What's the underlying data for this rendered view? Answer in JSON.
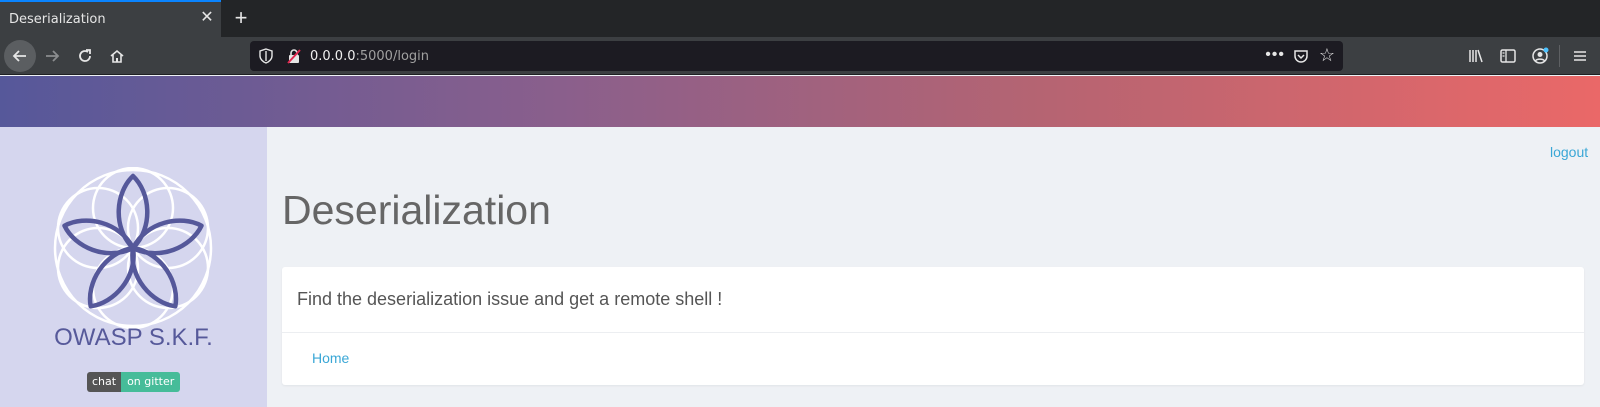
{
  "browser": {
    "tab_title": "Deserialization",
    "tab_close": "✕",
    "new_tab": "+",
    "url_host": "0.0.0.0",
    "url_path": ":5000/login",
    "url_more": "•••"
  },
  "sidebar": {
    "brand": "OWASP S.K.F.",
    "badge_left": "chat",
    "badge_right": "on gitter"
  },
  "header": {
    "logout": "logout"
  },
  "main": {
    "title": "Deserialization",
    "description": "Find the deserialization issue and get a remote shell !",
    "home_link": "Home"
  },
  "colors": {
    "accent_link": "#3aa7d6",
    "brand": "#56599a",
    "gradient_start": "#56589a",
    "gradient_end": "#ea6868"
  }
}
